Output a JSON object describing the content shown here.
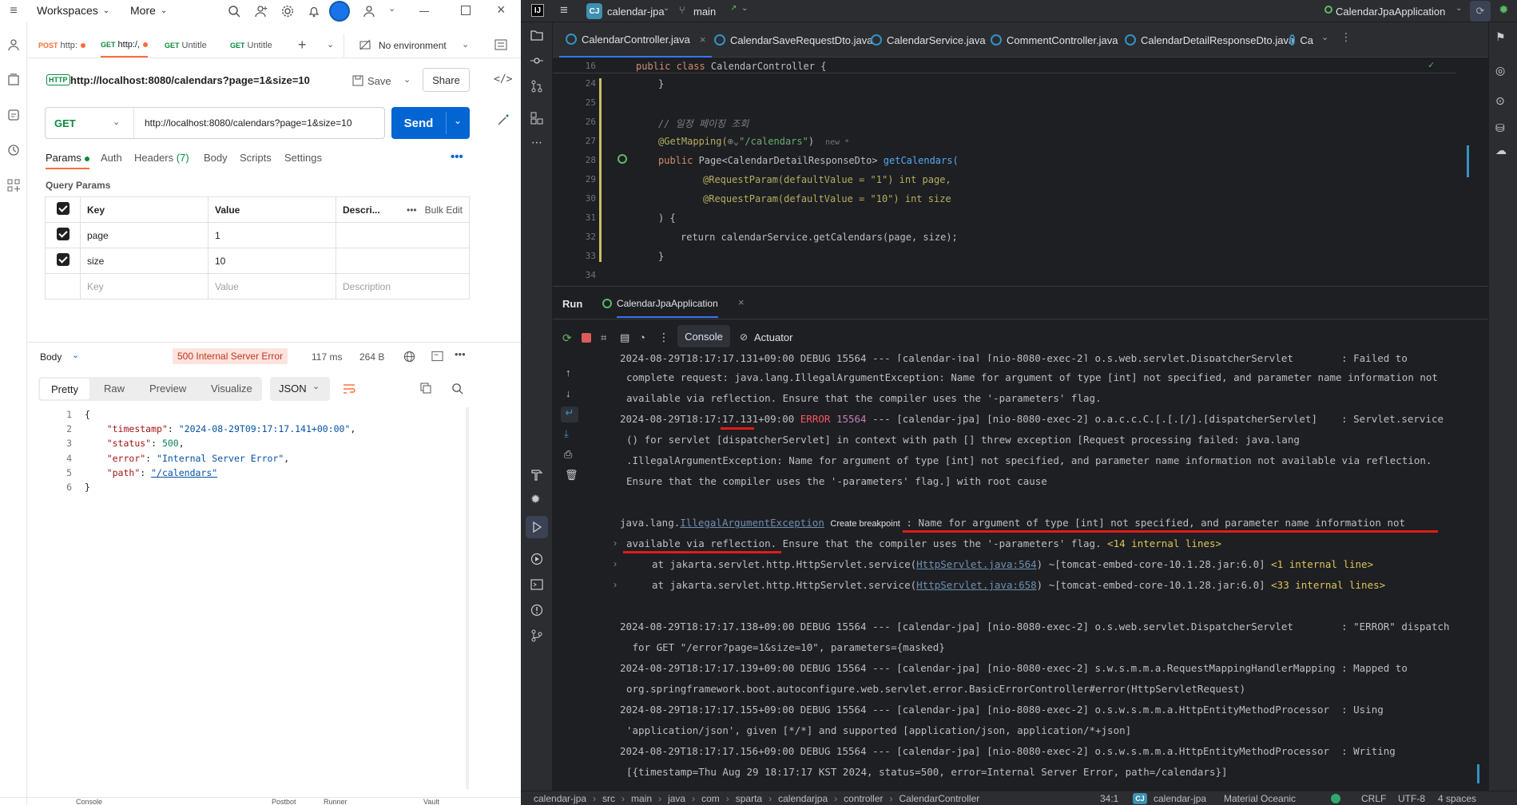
{
  "postman": {
    "topbar": {
      "workspaces": "Workspaces",
      "more": "More"
    },
    "tabs": [
      {
        "method": "POST",
        "label": "http:",
        "method_color": "#ff6c37"
      },
      {
        "method": "GET",
        "label": "http:/,",
        "method_color": "#0c8a3f"
      },
      {
        "method": "GET",
        "label": "Untitle",
        "method_color": "#0c8a3f"
      },
      {
        "method": "GET",
        "label": "Untitle",
        "method_color": "#0c8a3f"
      }
    ],
    "environment": "No environment",
    "request_title": "http://localhost:8080/calendars?page=1&size=10",
    "save_label": "Save",
    "share_label": "Share",
    "method": "GET",
    "url": "http://localhost:8080/calendars?page=1&size=10",
    "send_label": "Send",
    "subtabs": {
      "params": "Params",
      "auth": "Auth",
      "headers": "Headers",
      "headers_count": "(7)",
      "body": "Body",
      "scripts": "Scripts",
      "settings": "Settings"
    },
    "query_params_title": "Query Params",
    "table": {
      "headers": {
        "key": "Key",
        "value": "Value",
        "description": "Descri...",
        "bulk_edit": "Bulk Edit"
      },
      "rows": [
        {
          "key": "page",
          "value": "1"
        },
        {
          "key": "size",
          "value": "10"
        }
      ],
      "placeholder": {
        "key": "Key",
        "value": "Value",
        "description": "Description"
      }
    },
    "response": {
      "body_label": "Body",
      "status": "500 Internal Server Error",
      "time": "117 ms",
      "size": "264 B",
      "view_tabs": {
        "pretty": "Pretty",
        "raw": "Raw",
        "preview": "Preview",
        "visualize": "Visualize"
      },
      "format": "JSON",
      "json_lines": [
        {
          "n": "1",
          "pre": "{",
          "key": "",
          "val": "",
          "post": ""
        },
        {
          "n": "2",
          "pre": "    ",
          "key": "\"timestamp\"",
          "val": "\"2024-08-29T09:17:17.141+00:00\"",
          "post": ","
        },
        {
          "n": "3",
          "pre": "    ",
          "key": "\"status\"",
          "val": "500",
          "post": ","
        },
        {
          "n": "4",
          "pre": "    ",
          "key": "\"error\"",
          "val": "\"Internal Server Error\"",
          "post": ","
        },
        {
          "n": "5",
          "pre": "    ",
          "key": "\"path\"",
          "val": "\"/calendars\"",
          "post": ""
        },
        {
          "n": "6",
          "pre": "}",
          "key": "",
          "val": "",
          "post": ""
        }
      ]
    },
    "footer": {
      "console": "Console",
      "postbot": "Postbot",
      "runner": "Runner",
      "vault": "Vault"
    }
  },
  "ide": {
    "project": "calendar-jpa",
    "project_badge": "CJ",
    "branch": "main",
    "run_config": "CalendarJpaApplication",
    "editor_tabs": [
      "CalendarController.java",
      "CalendarSaveRequestDto.java",
      "CalendarService.java",
      "CommentController.java",
      "CalendarDetailResponseDto.java",
      "Ca"
    ],
    "code": {
      "sticky": "public class CalendarController {",
      "line_numbers": [
        "16",
        "24",
        "25",
        "26",
        "27",
        "28",
        "29",
        "30",
        "31",
        "32",
        "33",
        "34"
      ],
      "comment": "// 일정 페이징 조회",
      "mapping": "@GetMapping(",
      "mapping_path": "\"/calendars\"",
      "new_hint": "new *",
      "signature_start": "public ",
      "return_type": "Page<CalendarDetailResponseDto>",
      "method_name": "getCalendars(",
      "param1": "@RequestParam(defaultValue = \"1\") int page,",
      "param2": "@RequestParam(defaultValue = \"10\") int size",
      "close_paren": ") {",
      "return_stmt": "return calendarService.getCalendars(page, size);",
      "close_brace": "}"
    },
    "run_panel": {
      "run_label": "Run",
      "config_tab": "CalendarJpaApplication",
      "console_tab": "Console",
      "actuator_tab": "Actuator"
    },
    "console": {
      "l0": "2024-08-29T18:17:17.131+09:00 DEBUG 15564 --- [calendar-jpa] [nio-8080-exec-2] o.s.web.servlet.DispatcherServlet        : Failed to",
      "l1": "complete request: java.lang.IllegalArgumentException: Name for argument of type [int] not specified, and parameter name information not",
      "l2": "available via reflection. Ensure that the compiler uses the '-parameters' flag.",
      "l3_ts": "2024-08-29T18:17:17.131+09:00 ",
      "l3_level": "ERROR",
      "l3_pid": " 15564",
      "l3_rest": " --- [calendar-jpa] [nio-8080-exec-2] o.a.c.c.C.[.[.[/].[dispatcherServlet]    : Servlet.service",
      "l4": "() for servlet [dispatcherServlet] in context with path [] threw exception [Request processing failed: java.lang",
      "l5": ".IllegalArgumentException: Name for argument of type [int] not specified, and parameter name information not available via reflection.",
      "l6": "Ensure that the compiler uses the '-parameters' flag.] with root cause",
      "ex_class_prefix": "java.lang.",
      "ex_class": "IllegalArgumentException",
      "create_breakpoint": "Create breakpoint",
      "ex_msg1": " : Name for argument of type [int] not specified, and parameter name information not",
      "ex_msg2": "available via reflection.",
      "ex_msg2_rest": " Ensure that the compiler uses the '-parameters' flag. ",
      "internal14": "<14 internal lines>",
      "at1_pre": "at jakarta.servlet.http.HttpServlet.service(",
      "at1_link": "HttpServlet.java:564",
      "at1_post": ") ~[tomcat-embed-core-10.1.28.jar:6.0] ",
      "at1_internal": "<1 internal line>",
      "at2_pre": "at jakarta.servlet.http.HttpServlet.service(",
      "at2_link": "HttpServlet.java:658",
      "at2_post": ") ~[tomcat-embed-core-10.1.28.jar:6.0] ",
      "at2_internal": "<33 internal lines>",
      "d1": "2024-08-29T18:17:17.138+09:00 DEBUG 15564 --- [calendar-jpa] [nio-8080-exec-2] o.s.web.servlet.DispatcherServlet        : \"ERROR\" dispatch",
      "d1b": " for GET \"/error?page=1&size=10\", parameters={masked}",
      "d2": "2024-08-29T18:17:17.139+09:00 DEBUG 15564 --- [calendar-jpa] [nio-8080-exec-2] s.w.s.m.m.a.RequestMappingHandlerMapping : Mapped to",
      "d2b": "org.springframework.boot.autoconfigure.web.servlet.error.BasicErrorController#error(HttpServletRequest)",
      "d3": "2024-08-29T18:17:17.155+09:00 DEBUG 15564 --- [calendar-jpa] [nio-8080-exec-2] o.s.w.s.m.m.a.HttpEntityMethodProcessor  : Using",
      "d3b": "'application/json', given [*/*] and supported [application/json, application/*+json]",
      "d4": "2024-08-29T18:17:17.156+09:00 DEBUG 15564 --- [calendar-jpa] [nio-8080-exec-2] o.s.w.s.m.m.a.HttpEntityMethodProcessor  : Writing",
      "d4b": "[{timestamp=Thu Aug 29 18:17:17 KST 2024, status=500, error=Internal Server Error, path=/calendars}]"
    },
    "statusbar": {
      "breadcrumb": [
        "calendar-jpa",
        "src",
        "main",
        "java",
        "com",
        "sparta",
        "calendarjpa",
        "controller",
        "CalendarController"
      ],
      "position": "34:1",
      "module": "calendar-jpa",
      "theme": "Material Oceanic",
      "line_sep": "CRLF",
      "encoding": "UTF-8",
      "indent": "4 spaces"
    }
  }
}
